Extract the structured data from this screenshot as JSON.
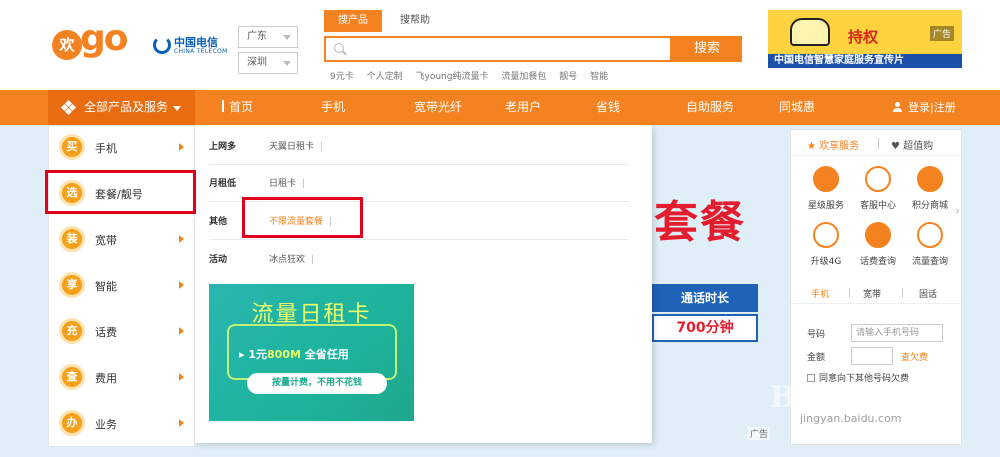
{
  "header": {
    "logo_huan": "欢",
    "logo_go": "go",
    "telecom_cn": "中国电信",
    "telecom_en": "CHINA TELECOM",
    "province": "广东",
    "city": "深圳",
    "search_tab_active": "搜产品",
    "search_tab_inactive": "搜帮助",
    "search_placeholder": "",
    "search_button": "搜索",
    "hot_links": [
      "9元卡",
      "个人定制",
      "飞young纯流量卡",
      "流量加餐包",
      "靓号",
      "智能"
    ],
    "ad": {
      "text": "持权",
      "tag": "广告",
      "bottom": "中国电信智慧家庭服务宣传片"
    }
  },
  "nav": {
    "all_products": "全部产品及服务",
    "items": [
      "首页",
      "手机",
      "宽带光纤",
      "老用户",
      "省钱",
      "自助服务",
      "同城惠"
    ],
    "login": "登录",
    "register": "注册",
    "login_sep": "|"
  },
  "sidebar": {
    "items": [
      {
        "icon": "买",
        "label": "手机"
      },
      {
        "icon": "选",
        "label": "套餐/靓号"
      },
      {
        "icon": "装",
        "label": "宽带"
      },
      {
        "icon": "享",
        "label": "智能"
      },
      {
        "icon": "充",
        "label": "话费"
      },
      {
        "icon": "查",
        "label": "费用"
      },
      {
        "icon": "办",
        "label": "业务"
      }
    ]
  },
  "dropdown": {
    "rows": [
      {
        "category": "上网多",
        "link": "天翼日租卡"
      },
      {
        "category": "月租低",
        "link": "日租卡"
      },
      {
        "category": "其他",
        "link": "不限流量套餐"
      },
      {
        "category": "活动",
        "link": "冰点狂欢"
      }
    ],
    "promo": {
      "title": "流量日租卡",
      "sub_prefix": "1元",
      "sub_highlight": "800M",
      "sub_suffix": "全省任用",
      "pill": "按量计费，不用不花钱"
    }
  },
  "banner": {
    "big_text": "套餐",
    "table_header": "通话时长",
    "table_value": "700分钟",
    "ad_tag": "广告"
  },
  "right_panel": {
    "tab_enjoy": "欢享服务",
    "tab_value": "超值购",
    "services": [
      {
        "label": "星级服务"
      },
      {
        "label": "客服中心"
      },
      {
        "label": "积分商城"
      },
      {
        "label": "升级4G"
      },
      {
        "label": "话费查询"
      },
      {
        "label": "流量查询"
      }
    ],
    "query_tabs": [
      "手机",
      "宽带",
      "固话"
    ],
    "number_label": "号码",
    "number_placeholder": "请输入手机号码",
    "amount_label": "金额",
    "owe_link": "查欠费",
    "agree_text": "同意向下其他号码欠费"
  },
  "watermark": {
    "main": "Bai度经验",
    "sub": "jingyan.baidu.com"
  }
}
